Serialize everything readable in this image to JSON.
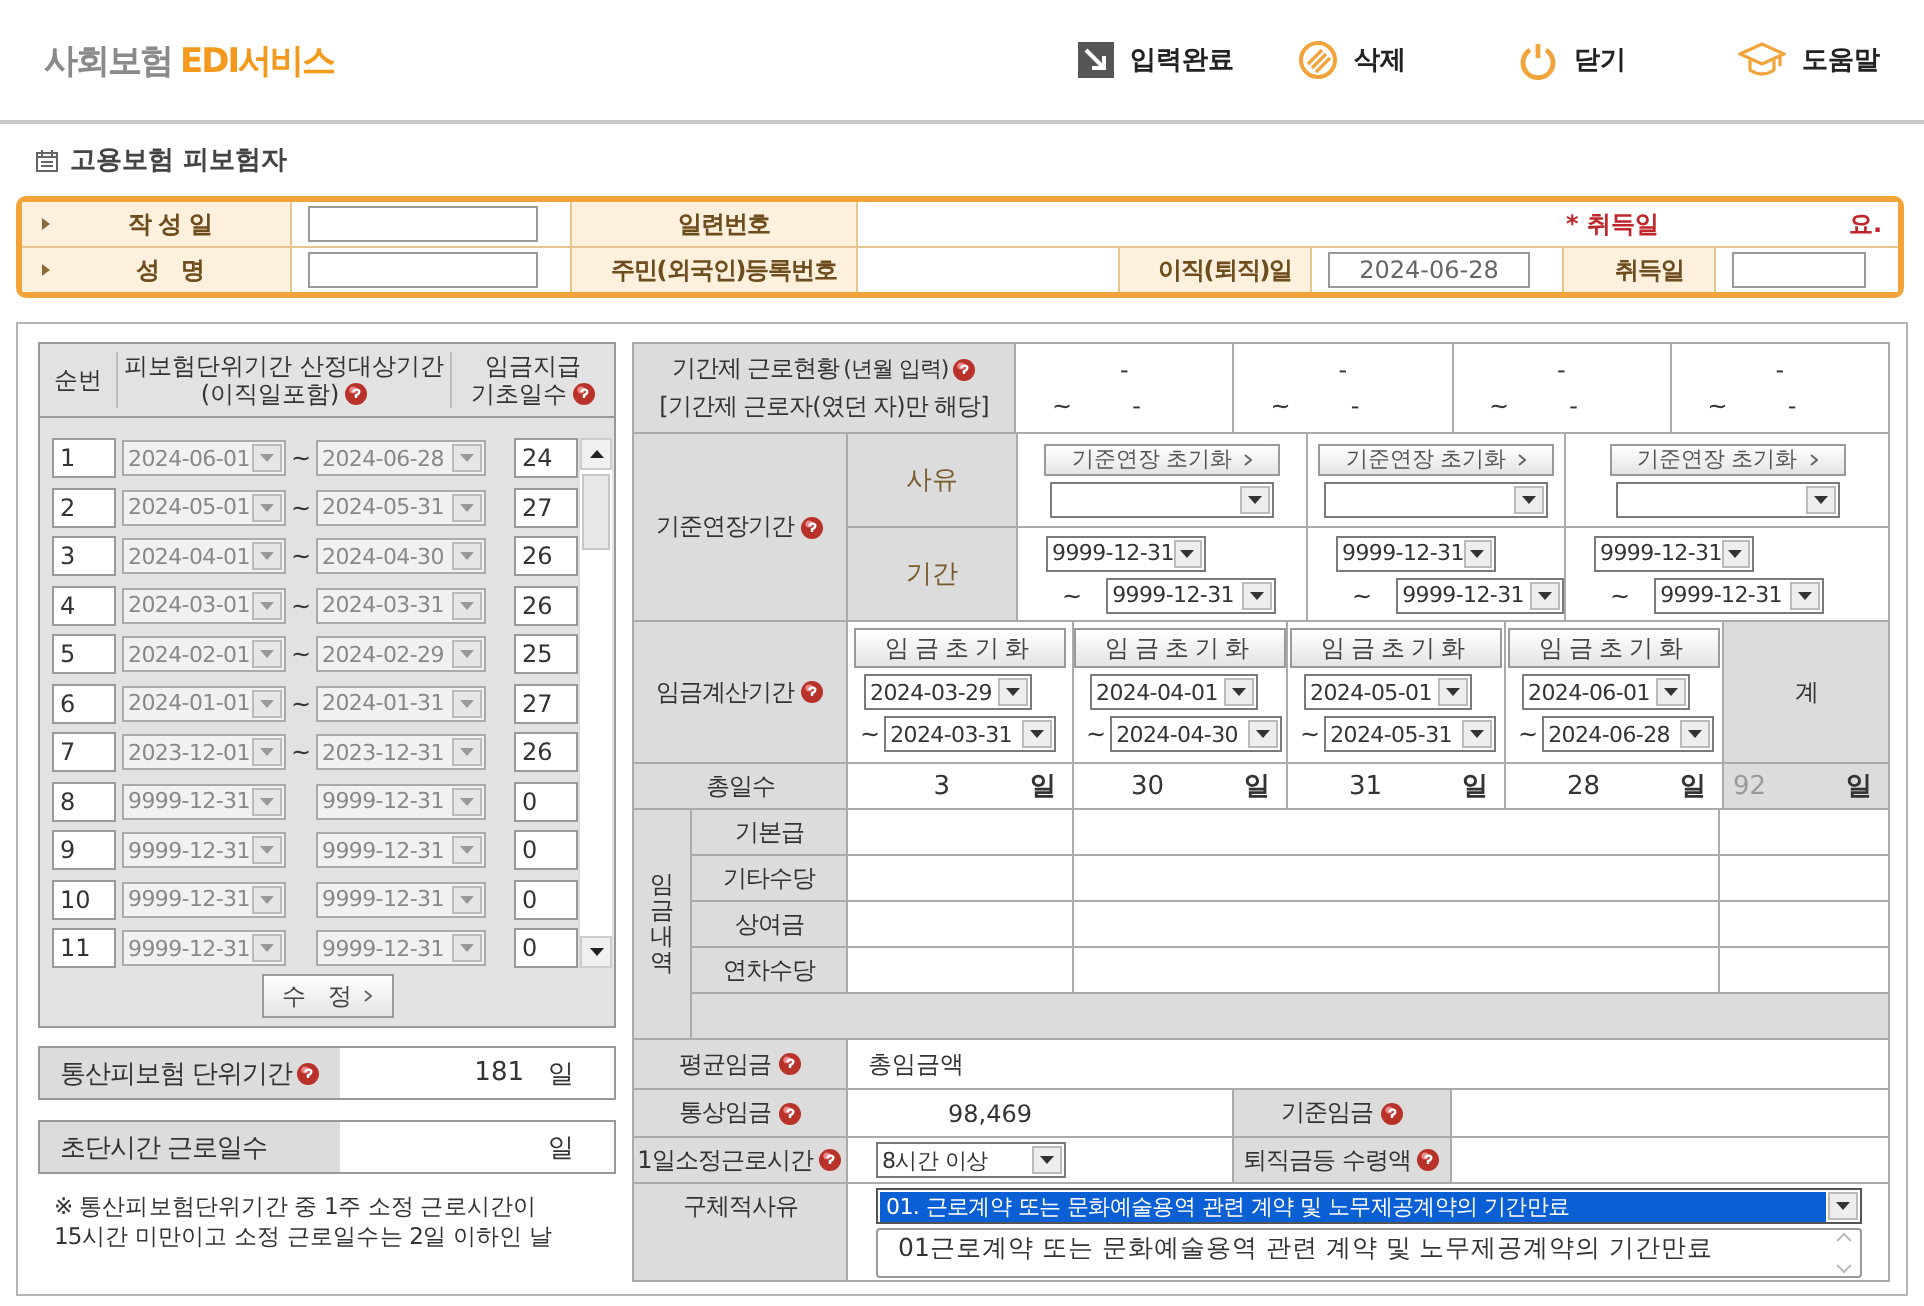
{
  "header": {
    "logo": {
      "service": "사회보험",
      "brand": "EDI서비스"
    },
    "actions": [
      {
        "kind": "complete",
        "label": "입력완료"
      },
      {
        "kind": "delete",
        "label": "삭제"
      },
      {
        "kind": "close",
        "label": "닫기"
      },
      {
        "kind": "help",
        "label": "도움말"
      }
    ]
  },
  "page_title": "고용보험 피보험자",
  "info": {
    "rows": [
      [
        {
          "kind": "label",
          "text": "작 성 일",
          "caret": true
        },
        {
          "kind": "input"
        },
        {
          "kind": "label",
          "text": "일련번호",
          "caret": false
        },
        {
          "kind": "value"
        },
        {
          "kind": "blank"
        },
        {
          "kind": "blank"
        },
        {
          "kind": "notice",
          "text": "* 취득일"
        },
        {
          "kind": "notice",
          "text": "요."
        }
      ],
      [
        {
          "kind": "label",
          "text": "성   명",
          "caret": true
        },
        {
          "kind": "input"
        },
        {
          "kind": "label",
          "text": "주민(외국인)등록번호",
          "caret": false
        },
        {
          "kind": "value"
        },
        {
          "kind": "label",
          "text": "이직(퇴직)일",
          "caret": false
        },
        {
          "kind": "input",
          "value": "2024-06-28"
        },
        {
          "kind": "label",
          "text": "취득일",
          "caret": false
        },
        {
          "kind": "input"
        }
      ]
    ]
  },
  "left_table": {
    "columns": [
      {
        "label": "순번"
      },
      {
        "label": "피보험단위기간 산정대상기간",
        "sub": "(이직일포함)",
        "help": true
      },
      {
        "label": "임금지급",
        "sub": "기초일수",
        "help": true
      }
    ],
    "rows": [
      {
        "no": "1",
        "from": "2024-06-01",
        "sep": "~",
        "to": "2024-06-28",
        "days": "24",
        "disabled": true
      },
      {
        "no": "2",
        "from": "2024-05-01",
        "sep": "~",
        "to": "2024-05-31",
        "days": "27",
        "disabled": true
      },
      {
        "no": "3",
        "from": "2024-04-01",
        "sep": "~",
        "to": "2024-04-30",
        "days": "26",
        "disabled": true
      },
      {
        "no": "4",
        "from": "2024-03-01",
        "sep": "~",
        "to": "2024-03-31",
        "days": "26",
        "disabled": true
      },
      {
        "no": "5",
        "from": "2024-02-01",
        "sep": "~",
        "to": "2024-02-29",
        "days": "25",
        "disabled": true
      },
      {
        "no": "6",
        "from": "2024-01-01",
        "sep": "~",
        "to": "2024-01-31",
        "days": "27",
        "disabled": true
      },
      {
        "no": "7",
        "from": "2023-12-01",
        "sep": "~",
        "to": "2023-12-31",
        "days": "26",
        "disabled": true
      },
      {
        "no": "8",
        "from": "9999-12-31",
        "to": "9999-12-31",
        "days": "0",
        "disabled": true
      },
      {
        "no": "9",
        "from": "9999-12-31",
        "to": "9999-12-31",
        "days": "0",
        "disabled": true
      },
      {
        "no": "10",
        "from": "9999-12-31",
        "to": "9999-12-31",
        "days": "0",
        "disabled": true
      },
      {
        "no": "11",
        "from": "9999-12-31",
        "to": "9999-12-31",
        "days": "0",
        "disabled": true
      }
    ],
    "edit_button": "수   정"
  },
  "unit_period": {
    "label": "통산피보험 단위기간",
    "help": true,
    "value": "181",
    "unit": "일"
  },
  "short_days": {
    "label": "초단시간 근로일수",
    "unit": "일"
  },
  "note_lines": [
    "※ 통산피보험단위기간 중 1주 소정 근로시간이",
    "15시간 미만이고 소정 근로일수는 2일 이하인 날"
  ],
  "fixed_term": {
    "label": "기간제 근로현황",
    "label_note": "(년월 입력)",
    "help": true,
    "label2": "[기간제 근로자(였던 자)만 해당]",
    "cells": [
      {
        "from": "-",
        "sep": "~",
        "to": "-"
      },
      {
        "from": "-",
        "sep": "~",
        "to": "-"
      },
      {
        "from": "-",
        "sep": "~",
        "to": "-"
      },
      {
        "from": "-",
        "sep": "~",
        "to": "-"
      }
    ]
  },
  "extension": {
    "label": "기준연장기간",
    "help": true,
    "reason_label": "사유",
    "period_label": "기간",
    "columns": [
      {
        "reset": "기준연장 초기화",
        "from": "9999-12-31",
        "sep": "~",
        "to": "9999-12-31"
      },
      {
        "reset": "기준연장 초기화",
        "from": "9999-12-31",
        "sep": "~",
        "to": "9999-12-31"
      },
      {
        "reset": "기준연장 초기화",
        "from": "9999-12-31",
        "sep": "~",
        "to": "9999-12-31"
      }
    ]
  },
  "wage_period": {
    "label": "임금계산기간",
    "help": true,
    "total_label": "계",
    "days_label": "총일수",
    "columns": [
      {
        "reset": "임금초기화",
        "from": "2024-03-29",
        "sep": "~",
        "to": "2024-03-31",
        "days": "3",
        "unit": "일"
      },
      {
        "reset": "임금초기화",
        "from": "2024-04-01",
        "sep": "~",
        "to": "2024-04-30",
        "days": "30",
        "unit": "일"
      },
      {
        "reset": "임금초기화",
        "from": "2024-05-01",
        "sep": "~",
        "to": "2024-05-31",
        "days": "31",
        "unit": "일"
      },
      {
        "reset": "임금초기화",
        "from": "2024-06-01",
        "sep": "~",
        "to": "2024-06-28",
        "days": "28",
        "unit": "일"
      }
    ],
    "total_days": "92",
    "total_unit": "일"
  },
  "wage_detail": {
    "label": "임금내역",
    "items": [
      "기본급",
      "기타수당",
      "상여금",
      "연차수당"
    ]
  },
  "avg_wage": {
    "label": "평균임금",
    "help": true,
    "text": "총임금액"
  },
  "ordinary_wage": {
    "label": "통상임금",
    "help": true,
    "value": "98,469",
    "base_label": "기준임금",
    "base_help": true
  },
  "work_hours": {
    "label": "1일소정근로시간",
    "help": true,
    "value": "8시간 이상",
    "severance_label": "퇴직금등 수령액",
    "severance_help": true
  },
  "reason": {
    "label": "구체적사유",
    "selected": "01. 근로계약 또는 문화예술용역 관련 계약 및 노무제공계약의 기간만료",
    "text": "01근로계약 또는 문화예술용역 관련 계약 및 노무제공계약의 기간만료"
  }
}
